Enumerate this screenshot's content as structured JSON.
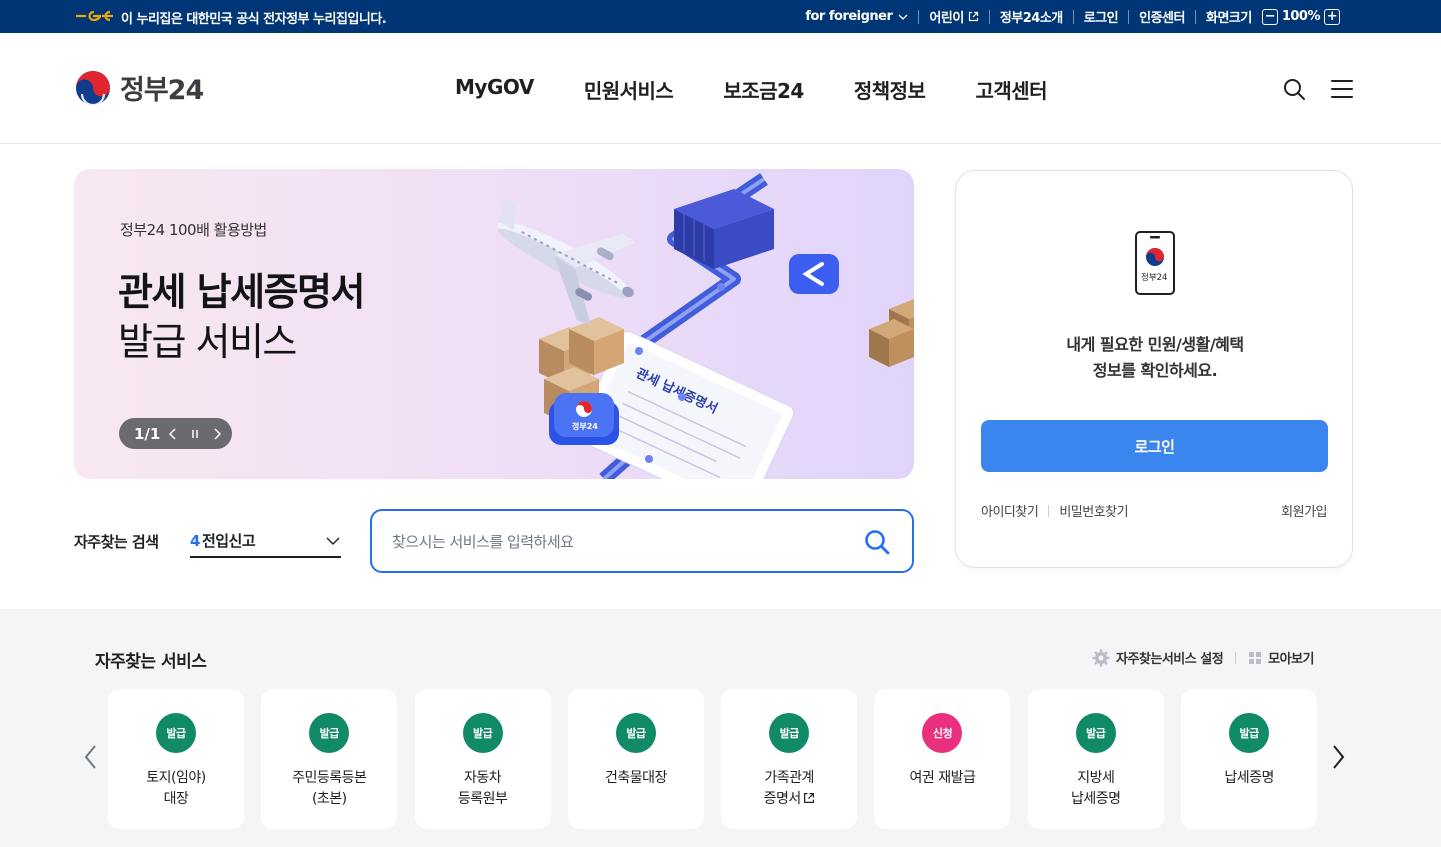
{
  "topbar": {
    "gov_text": "이 누리집은 대한민국 공식 전자정부 누리집입니다.",
    "foreigner": "for foreigner",
    "kids": "어린이",
    "about": "정부24소개",
    "login": "로그인",
    "cert": "인증센터",
    "zoom_label": "화면크기",
    "zoom_minus": "−",
    "zoom_value": "100%",
    "zoom_plus": "+"
  },
  "header": {
    "logo_text": "정부24",
    "nav": [
      "MyGOV",
      "민원서비스",
      "보조금24",
      "정책정보",
      "고객센터"
    ]
  },
  "banner": {
    "eyebrow": "정부24 100배 활용방법",
    "title_line1": "관세 납세증명서",
    "title_line2": "발급 서비스",
    "pager": "1/1",
    "doc_label": "관세 납세증명서",
    "badge_label": "정부24"
  },
  "search": {
    "freq_label": "자주찾는 검색",
    "freq_num": "4",
    "freq_value": "전입신고",
    "placeholder": "찾으시는 서비스를 입력하세요"
  },
  "login_card": {
    "phone_label": "정부24",
    "desc_line1": "내게 필요한 민원/생활/혜택",
    "desc_line2": "정보를 확인하세요.",
    "login_button": "로그인",
    "find_id": "아이디찾기",
    "find_pw": "비밀번호찾기",
    "join": "회원가입"
  },
  "services": {
    "title": "자주찾는 서비스",
    "settings": "자주찾는서비스 설정",
    "view_all": "모아보기",
    "items": [
      {
        "badge": "발급",
        "line1": "토지(임야)",
        "line2": "대장",
        "color": "#118a67"
      },
      {
        "badge": "발급",
        "line1": "주민등록등본",
        "line2": "(초본)",
        "color": "#118a67"
      },
      {
        "badge": "발급",
        "line1": "자동차",
        "line2": "등록원부",
        "color": "#118a67"
      },
      {
        "badge": "발급",
        "line1": "건축물대장",
        "line2": "",
        "color": "#118a67"
      },
      {
        "badge": "발급",
        "line1": "가족관계",
        "line2": "증명서",
        "color": "#118a67"
      },
      {
        "badge": "신청",
        "line1": "여권 재발급",
        "line2": "",
        "color": "#e8307e"
      },
      {
        "badge": "발급",
        "line1": "지방세",
        "line2": "납세증명",
        "color": "#118a67"
      },
      {
        "badge": "발급",
        "line1": "납세증명",
        "line2": "",
        "color": "#118a67"
      }
    ]
  },
  "colors": {
    "topbar_bg": "#003675",
    "primary": "#256ef4",
    "login_btn": "#3a86ee",
    "issue_badge": "#118a67",
    "apply_badge": "#e8307e"
  }
}
